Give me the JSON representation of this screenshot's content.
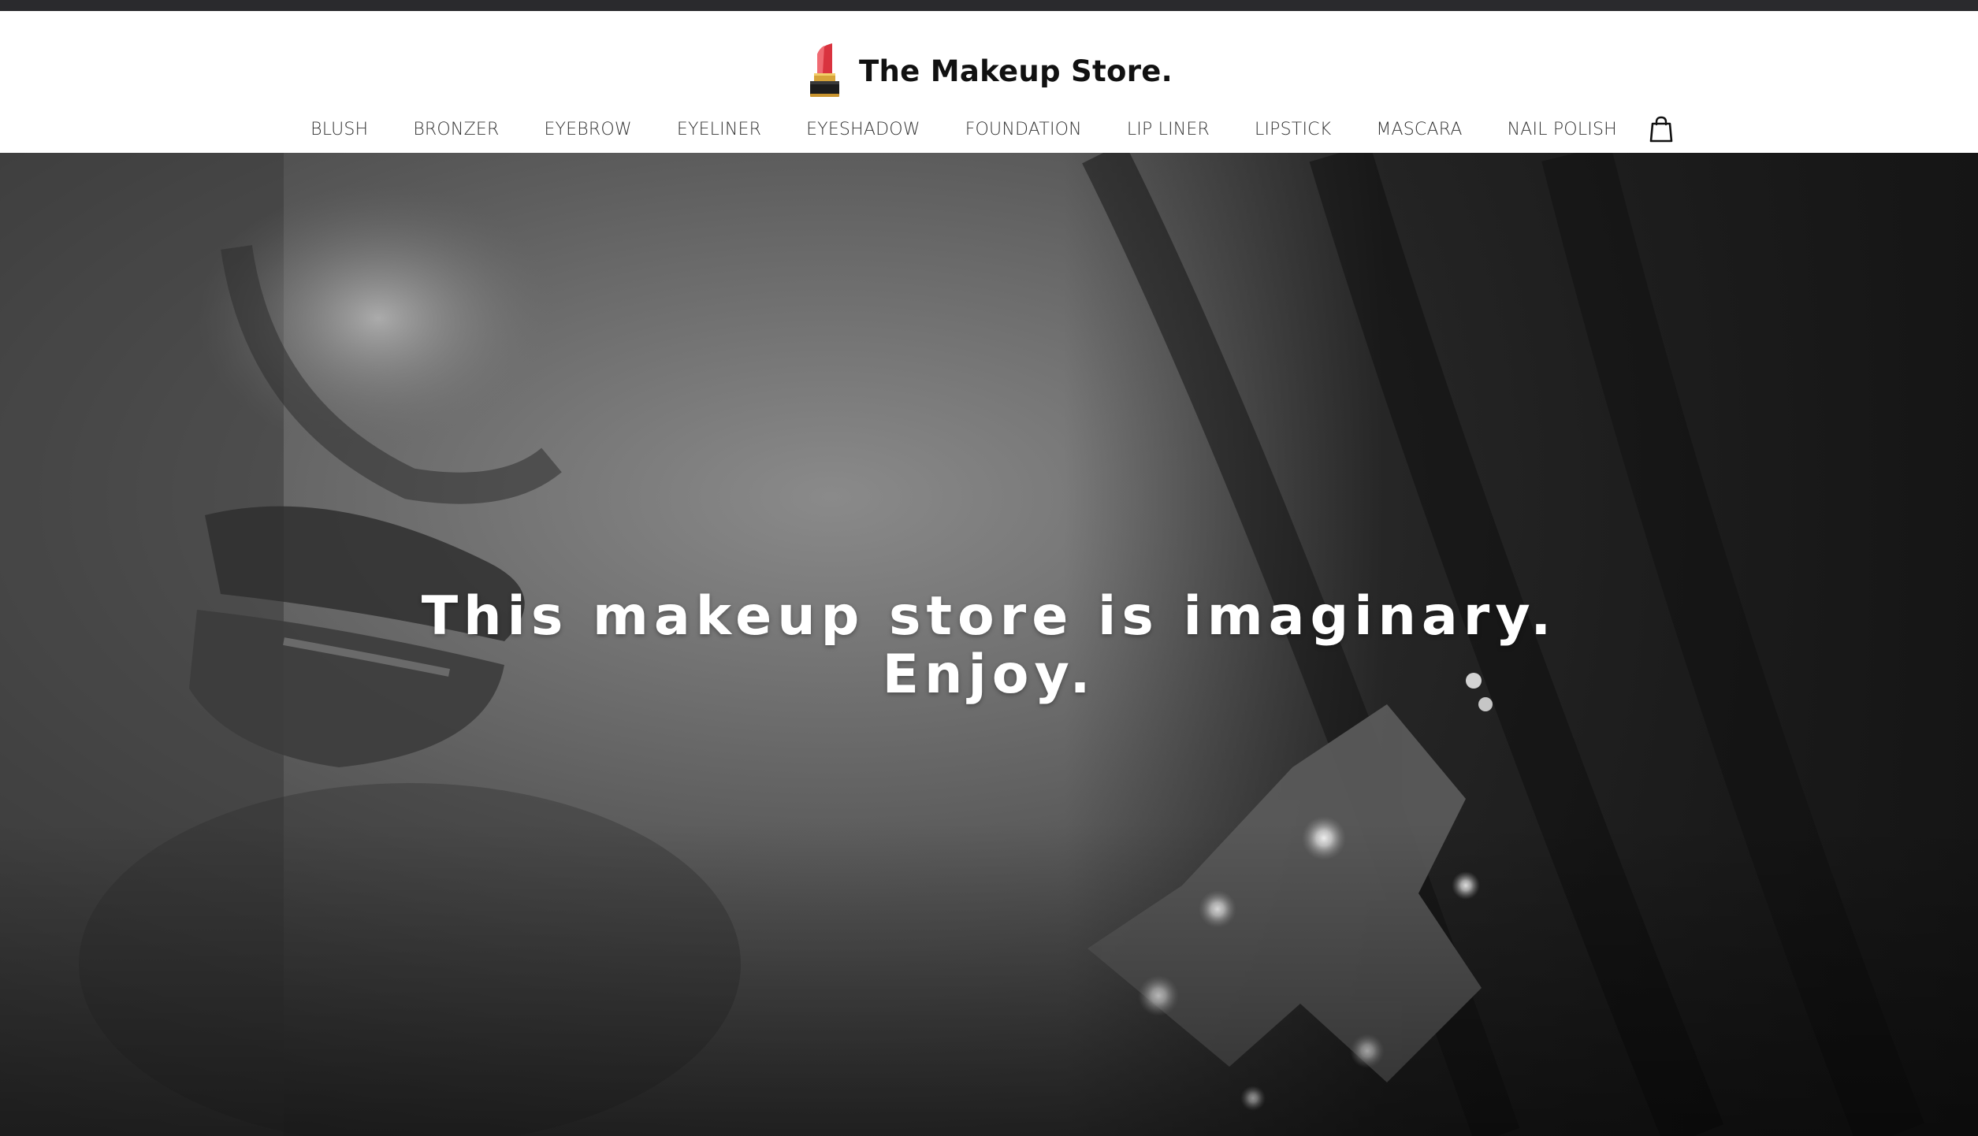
{
  "brand": {
    "name": "The Makeup Store.",
    "logo_icon": "lipstick-icon"
  },
  "nav": {
    "items": [
      {
        "label": "BLUSH"
      },
      {
        "label": "BRONZER"
      },
      {
        "label": "EYEBROW"
      },
      {
        "label": "EYELINER"
      },
      {
        "label": "EYESHADOW"
      },
      {
        "label": "FOUNDATION"
      },
      {
        "label": "LIP LINER"
      },
      {
        "label": "LIPSTICK"
      },
      {
        "label": "MASCARA"
      },
      {
        "label": "NAIL POLISH"
      }
    ],
    "cart_icon": "shopping-bag-icon"
  },
  "hero": {
    "line1": "This makeup store is imaginary.",
    "line2": "Enjoy."
  },
  "colors": {
    "top_strip": "#2a2a2d",
    "header_bg": "#ffffff",
    "nav_text": "#333333",
    "hero_text": "#ffffff"
  }
}
